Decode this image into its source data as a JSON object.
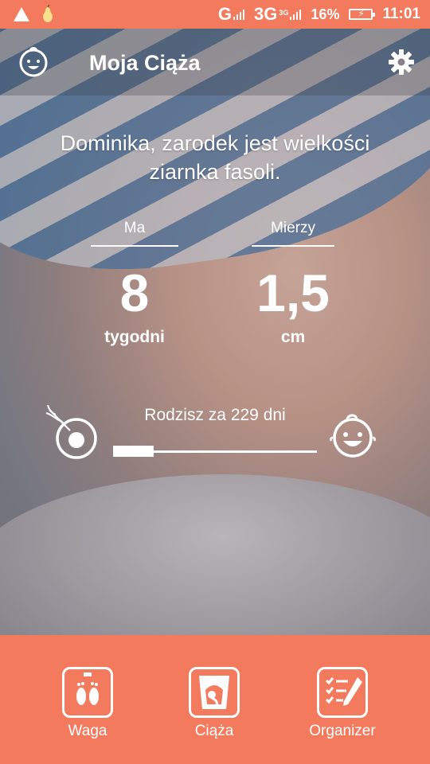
{
  "status_bar": {
    "network_1": "G",
    "network_2": "3G",
    "network_2_sup": "3G",
    "battery": "16%",
    "time": "11:01"
  },
  "toolbar": {
    "title": "Moja Ciąża",
    "logo_icon": "baby-face-icon",
    "settings_icon": "gear-icon"
  },
  "main": {
    "headline_line1": "Dominika, zarodek jest wielkości",
    "headline_line2": "ziarnka fasoli.",
    "age": {
      "label": "Ma",
      "value": "8",
      "unit": "tygodni"
    },
    "size": {
      "label": "Mierzy",
      "value": "1,5",
      "unit": "cm"
    },
    "countdown": "Rodzisz za 229 dni",
    "progress_fraction": 0.2,
    "start_icon": "sperm-egg-icon",
    "end_icon": "baby-face-icon"
  },
  "bottom_nav": {
    "items": [
      {
        "label": "Waga",
        "icon": "footprints-scale-icon"
      },
      {
        "label": "Ciąża",
        "icon": "ultrasound-icon"
      },
      {
        "label": "Organizer",
        "icon": "checklist-icon"
      }
    ]
  },
  "colors": {
    "accent": "#f47a5e",
    "text_on_image": "#ffffff"
  }
}
